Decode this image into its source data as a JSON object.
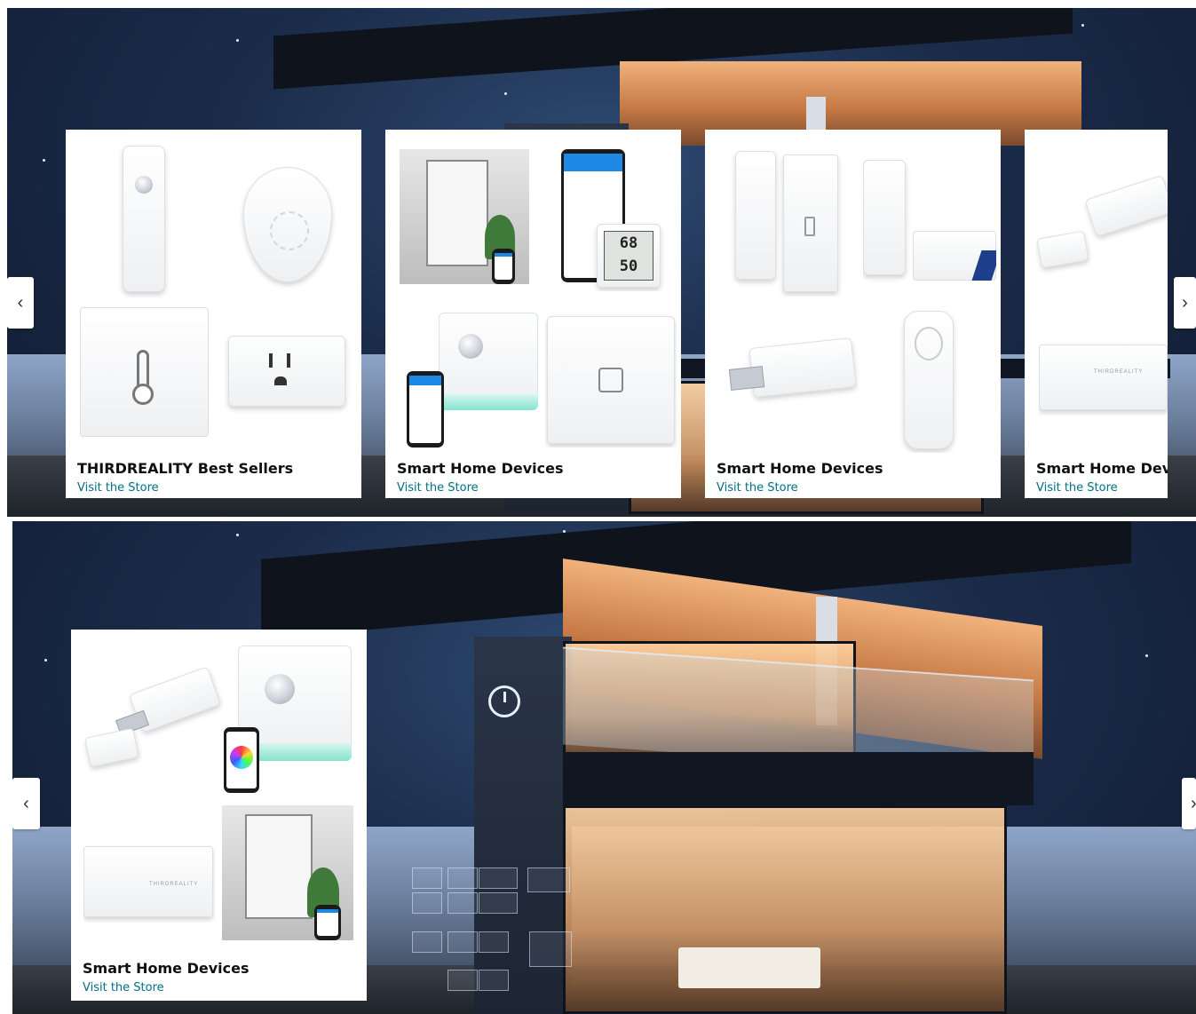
{
  "banners": [
    {
      "cards": [
        {
          "title": "THIRDREALITY Best Sellers",
          "link": "Visit the Store"
        },
        {
          "title": "Smart Home Devices",
          "link": "Visit the Store"
        },
        {
          "title": "Smart Home Devices",
          "link": "Visit the Store"
        },
        {
          "title": "Smart Home Devices",
          "link": "Visit the Store"
        }
      ],
      "prev_icon": "chevron-left-icon",
      "next_icon": "chevron-right-icon"
    },
    {
      "cards": [
        {
          "title": "Smart Home Devices",
          "link": "Visit the Store"
        }
      ],
      "prev_icon": "chevron-left-icon",
      "next_icon": "chevron-right-icon"
    }
  ],
  "arrows": {
    "prev": "‹",
    "next": "›"
  },
  "device_text": {
    "humidity_top": "68",
    "humidity_bottom": "50",
    "brand": "THIRDREALITY"
  },
  "colors": {
    "link": "#007185",
    "title": "#0f1111",
    "night_sky": "#1b2c4a"
  }
}
